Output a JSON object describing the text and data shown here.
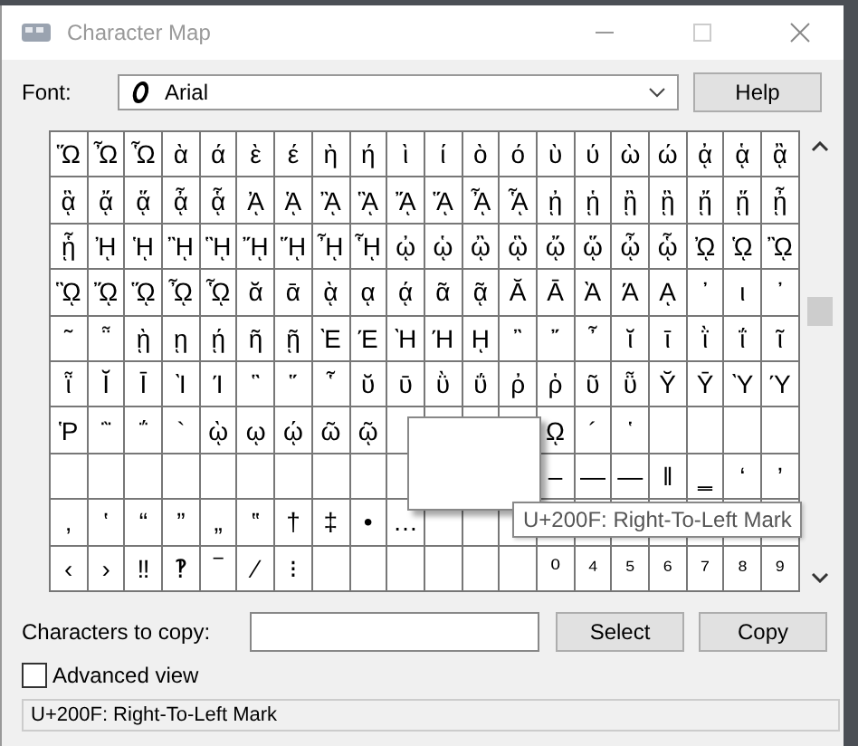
{
  "window": {
    "title": "Character Map"
  },
  "font": {
    "label": "Font:",
    "value": "Arial"
  },
  "help_button": "Help",
  "grid": {
    "rows": [
      [
        "Ὥ",
        "Ὦ",
        "Ὧ",
        "ὰ",
        "ά",
        "ὲ",
        "έ",
        "ὴ",
        "ή",
        "ὶ",
        "ί",
        "ὸ",
        "ό",
        "ὺ",
        "ύ",
        "ὼ",
        "ώ",
        "ᾀ",
        "ᾁ",
        "ᾂ"
      ],
      [
        "ᾃ",
        "ᾄ",
        "ᾅ",
        "ᾆ",
        "ᾇ",
        "ᾈ",
        "ᾉ",
        "ᾊ",
        "ᾋ",
        "ᾌ",
        "ᾍ",
        "ᾎ",
        "ᾏ",
        "ᾐ",
        "ᾑ",
        "ᾒ",
        "ᾓ",
        "ᾔ",
        "ᾕ",
        "ᾖ"
      ],
      [
        "ᾗ",
        "ᾘ",
        "ᾙ",
        "ᾚ",
        "ᾛ",
        "ᾜ",
        "ᾝ",
        "ᾞ",
        "ᾟ",
        "ᾠ",
        "ᾡ",
        "ᾢ",
        "ᾣ",
        "ᾤ",
        "ᾥ",
        "ᾦ",
        "ᾧ",
        "ᾨ",
        "ᾩ",
        "ᾪ"
      ],
      [
        "ᾫ",
        "ᾬ",
        "ᾭ",
        "ᾮ",
        "ᾯ",
        "ᾰ",
        "ᾱ",
        "ᾲ",
        "ᾳ",
        "ᾴ",
        "ᾶ",
        "ᾷ",
        "Ᾰ",
        "Ᾱ",
        "Ὰ",
        "Ά",
        "ᾼ",
        "᾽",
        "ι",
        "᾿"
      ],
      [
        "῀",
        "῁",
        "ῂ",
        "ῃ",
        "ῄ",
        "ῆ",
        "ῇ",
        "Ὲ",
        "Έ",
        "Ὴ",
        "Ή",
        "ῌ",
        "῍",
        "῎",
        "῏",
        "ῐ",
        "ῑ",
        "ῒ",
        "ΐ",
        "ῖ"
      ],
      [
        "ῗ",
        "Ῐ",
        "Ῑ",
        "Ὶ",
        "Ί",
        "῝",
        "῞",
        "῟",
        "ῠ",
        "ῡ",
        "ῢ",
        "ΰ",
        "ῤ",
        "ῥ",
        "ῦ",
        "ῧ",
        "Ῠ",
        "Ῡ",
        "Ὺ",
        "Ύ"
      ],
      [
        "Ῥ",
        "῭",
        "΅",
        "`",
        "ῲ",
        "ῳ",
        "ῴ",
        "ῶ",
        "ῷ",
        null,
        null,
        null,
        null,
        "ῼ",
        "´",
        "῾",
        null,
        null,
        null,
        null
      ],
      [
        null,
        null,
        null,
        null,
        null,
        null,
        null,
        null,
        null,
        null,
        null,
        null,
        null,
        "–",
        "—",
        "―",
        "‖",
        "‗",
        "‘",
        "’"
      ],
      [
        "‚",
        "‛",
        "“",
        "”",
        "„",
        "‟",
        "†",
        "‡",
        "•",
        "…",
        null,
        null,
        null,
        null,
        null,
        null,
        null,
        null,
        null,
        null
      ],
      [
        "‹",
        "›",
        "‼",
        "‽",
        "‾",
        "⁄",
        "⁝",
        null,
        null,
        null,
        null,
        null,
        null,
        "⁰",
        "⁴",
        "⁵",
        "⁶",
        "⁷",
        "⁸",
        "⁹"
      ]
    ]
  },
  "tooltip": "U+200F: Right-To-Left Mark",
  "copy": {
    "label": "Characters to copy:"
  },
  "select_button": "Select",
  "copy_button": "Copy",
  "advanced_view": {
    "label": "Advanced view",
    "checked": false
  },
  "status_bar": "U+200F: Right-To-Left Mark"
}
